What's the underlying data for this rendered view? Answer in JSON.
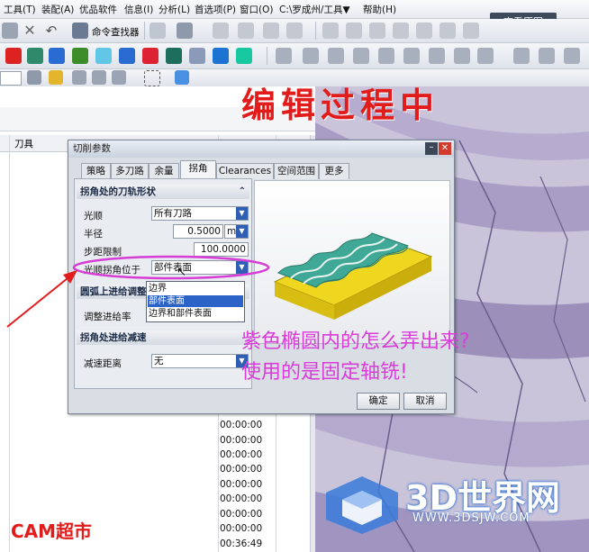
{
  "menubar": {
    "items": [
      "工具(T)",
      "装配(A)",
      "优品软件",
      "信息(I)",
      "分析(L)",
      "首选项(P)",
      "窗口(O)",
      "C:\\罗成州/工具▼",
      "帮助(H)"
    ]
  },
  "view_original_label": "查看原图",
  "toolbar": {
    "command_finder_label": "命令查找器"
  },
  "table": {
    "column_tool": "刀具",
    "times": [
      "00:00:00",
      "00:00:00",
      "00:00:00",
      "00:00:00",
      "00:00:00",
      "00:00:00",
      "00:00:00",
      "00:00:00",
      "00:00:00",
      "00:36:49"
    ]
  },
  "dialog": {
    "title": "切削参数",
    "tabs": [
      "策略",
      "多刀路",
      "余量",
      "拐角",
      "Clearances",
      "空间范围",
      "更多"
    ],
    "active_tab": "拐角",
    "section1": {
      "title": "拐角处的刀轨形状",
      "smooth_label": "光顺",
      "smooth_value": "所有刀路",
      "radius_label": "半径",
      "radius_value": "0.5000",
      "radius_unit": "mm",
      "step_limit_label": "步距限制",
      "step_limit_value": "100.0000",
      "smooth_corner_label": "光顺拐角位于",
      "smooth_corner_value": "部件表面",
      "dropdown_options": [
        "边界",
        "部件表面",
        "边界和部件表面"
      ],
      "dropdown_selected": "部件表面"
    },
    "section2": {
      "title": "圆弧上进给调整",
      "adjust_label": "调整进给率"
    },
    "section3": {
      "title": "拐角处进给减速",
      "slowdown_label": "减速距离",
      "slowdown_value": "无"
    },
    "ok_label": "确定",
    "cancel_label": "取消"
  },
  "overlay": {
    "headline": "编辑过程中",
    "question_line1": "紫色椭圆内的怎么弄出来?",
    "question_line2": "使用的是固定轴铣!",
    "brand": "CAM超市",
    "highlight_color": "#d63cd6",
    "headline_color": "#e21b1b"
  },
  "watermark": {
    "name": "3D世界网",
    "url": "WWW.3DSJW.COM"
  }
}
